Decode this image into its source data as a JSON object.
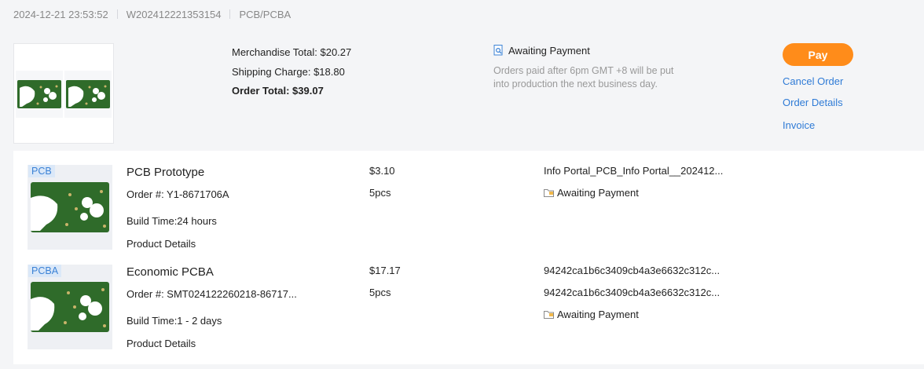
{
  "header": {
    "datetime": "2024-12-21 23:53:52",
    "order_id": "W202412221353154",
    "category": "PCB/PCBA"
  },
  "summary": {
    "merchandise_total": "Merchandise Total: $20.27",
    "shipping_charge": "Shipping Charge: $18.80",
    "order_total": "Order Total: $39.07",
    "status": "Awaiting Payment",
    "note_line1": "Orders paid after 6pm GMT +8 will be put",
    "note_line2": "into production the next business day.",
    "pay_label": "Pay",
    "cancel_label": "Cancel Order",
    "details_label": "Order Details",
    "invoice_label": "Invoice"
  },
  "items": [
    {
      "tag": "PCB",
      "name": "PCB Prototype",
      "order_no": "Order #: Y1-8671706A",
      "build_time": "Build Time:24 hours",
      "details_link": "Product Details",
      "price": "$3.10",
      "qty": "5pcs",
      "info1": "Info Portal_PCB_Info Portal__202412...",
      "status": "Awaiting Payment"
    },
    {
      "tag": "PCBA",
      "name": "Economic PCBA",
      "order_no": "Order #: SMT024122260218-86717...",
      "build_time": "Build Time:1 - 2 days",
      "details_link": "Product Details",
      "price": "$17.17",
      "qty": "5pcs",
      "info1": "94242ca1b6c3409cb4a3e6632c312c...",
      "info2": "94242ca1b6c3409cb4a3e6632c312c...",
      "status": "Awaiting Payment"
    }
  ],
  "colors": {
    "accent": "#ff8c1a",
    "link": "#2f7bd6",
    "board_green": "#2f6b2a"
  }
}
